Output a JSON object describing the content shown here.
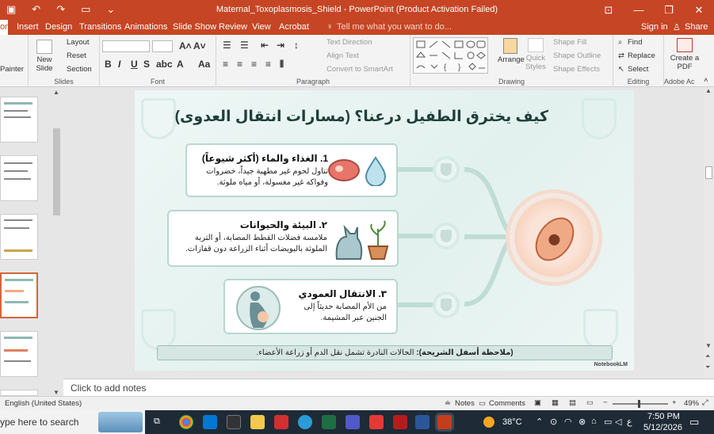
{
  "window": {
    "title": "Maternal_Toxoplasmosis_Shield - PowerPoint (Product Activation Failed)"
  },
  "tabs": [
    "Home",
    "Insert",
    "Design",
    "Transitions",
    "Animations",
    "Slide Show",
    "Review",
    "View",
    "Acrobat"
  ],
  "tell_me": "Tell me what you want to do...",
  "signin": "Sign in",
  "share": "Share",
  "ribbon": {
    "clipboard_partial": "Painter",
    "new_slide": "New Slide",
    "layout": "Layout",
    "reset": "Reset",
    "section": "Section",
    "slides_label": "Slides",
    "font_label": "Font",
    "text_direction": "Text Direction",
    "align_text": "Align Text",
    "convert_smartart": "Convert to SmartArt",
    "paragraph_label": "Paragraph",
    "arrange": "Arrange",
    "quick_styles": "Quick Styles",
    "shape_fill": "Shape Fill",
    "shape_outline": "Shape Outline",
    "shape_effects": "Shape Effects",
    "drawing_label": "Drawing",
    "find": "Find",
    "replace": "Replace",
    "select": "Select",
    "editing_label": "Editing",
    "create_pdf": "Create a PDF",
    "adobe_label": "Adobe Ac"
  },
  "slide": {
    "title": "كيف يخترق الطفيل درعنا؟ (مسارات انتقال العدوى)",
    "cards": [
      {
        "title": "1. الغذاء والماء (أكثر شيوعاً)",
        "body": "تناول لحوم غير مطهية جيداً، خضروات وفواكه غير مغسولة، أو مياه ملوثة."
      },
      {
        "title": "٢. البيئة والحيوانات",
        "body": "ملامسة فضلات القطط المصابة، أو التربة الملوثة بالبويضات أثناء الزراعة دون قفازات."
      },
      {
        "title": "٣. الانتقال العمودي",
        "body": "من الأم المصابة حديثاً إلى الجنين عبر المشيمة."
      }
    ],
    "note_bold": "(ملاحظة أسفل الشريحة):",
    "note_text": "الحالات النادرة تشمل نقل الدم أو زراعة الأعضاء.",
    "watermark": "NotebookLM"
  },
  "notes_placeholder": "Click to add notes",
  "status": {
    "language": "English (United States)",
    "notes": "Notes",
    "comments": "Comments",
    "zoom": "49%"
  },
  "taskbar": {
    "search": "ype here to search",
    "temp": "38°C",
    "time": "7:50 PM",
    "date": "5/12/2026",
    "lang": "ع"
  }
}
